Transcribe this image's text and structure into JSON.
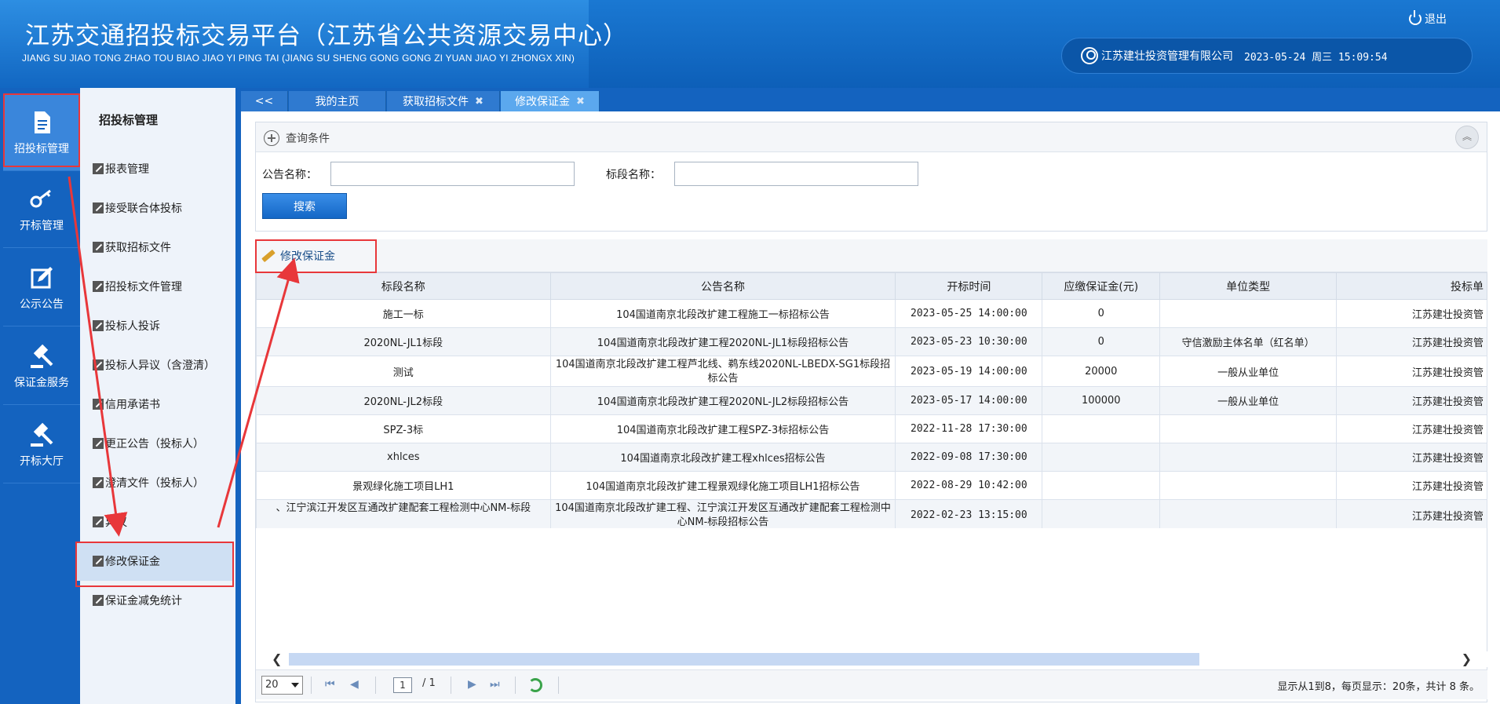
{
  "header": {
    "title_cn": "江苏交通招投标交易平台（江苏省公共资源交易中心）",
    "title_en": "JIANG SU JIAO TONG ZHAO TOU BIAO JIAO YI PING TAI  (JIANG SU SHENG GONG GONG ZI YUAN JIAO YI ZHONGX XIN)",
    "logout_label": "退出",
    "company": "江苏建壮投资管理有限公司",
    "datetime": "2023-05-24 周三 15:09:54"
  },
  "icon_nav": [
    {
      "label": "招投标管理",
      "icon": "document-icon"
    },
    {
      "label": "开标管理",
      "icon": "key-icon"
    },
    {
      "label": "公示公告",
      "icon": "edit-icon"
    },
    {
      "label": "保证金服务",
      "icon": "gavel-icon"
    },
    {
      "label": "开标大厅",
      "icon": "gavel-icon"
    }
  ],
  "sub_nav": {
    "title": "招投标管理",
    "items": [
      "报表管理",
      "接受联合体投标",
      "获取招标文件",
      "招投标文件管理",
      "投标人投诉",
      "投标人异议（含澄清）",
      "信用承诺书",
      "更正公告（投标人）",
      "澄清文件（投标人）",
      "异议",
      "修改保证金",
      "保证金减免统计"
    ]
  },
  "tabs": {
    "back_label": "<<",
    "items": [
      {
        "label": "我的主页",
        "closable": false
      },
      {
        "label": "获取招标文件",
        "closable": true
      },
      {
        "label": "修改保证金",
        "closable": true
      }
    ],
    "close_glyph": "✖"
  },
  "query": {
    "title": "查询条件",
    "field1_label": "公告名称：",
    "field1_value": "",
    "field2_label": "标段名称：",
    "field2_value": "",
    "search_label": "搜索"
  },
  "toolbar": {
    "edit_label": "修改保证金"
  },
  "table": {
    "columns": [
      "标段名称",
      "公告名称",
      "开标时间",
      "应缴保证金(元)",
      "单位类型",
      "投标单"
    ],
    "rows": [
      [
        "施工一标",
        "104国道南京北段改扩建工程施工一标招标公告",
        "2023-05-25 14:00:00",
        "0",
        "",
        "江苏建壮投资管"
      ],
      [
        "2020NL-JL1标段",
        "104国道南京北段改扩建工程2020NL-JL1标段招标公告",
        "2023-05-23 10:30:00",
        "0",
        "守信激励主体名单（红名单）",
        "江苏建壮投资管"
      ],
      [
        "测试",
        "104国道南京北段改扩建工程芦北线、鹈东线2020NL-LBEDX-SG1标段招标公告",
        "2023-05-19 14:00:00",
        "20000",
        "一般从业单位",
        "江苏建壮投资管"
      ],
      [
        "2020NL-JL2标段",
        "104国道南京北段改扩建工程2020NL-JL2标段招标公告",
        "2023-05-17 14:00:00",
        "100000",
        "一般从业单位",
        "江苏建壮投资管"
      ],
      [
        "SPZ-3标",
        "104国道南京北段改扩建工程SPZ-3标招标公告",
        "2022-11-28 17:30:00",
        "",
        "",
        "江苏建壮投资管"
      ],
      [
        "xhlces",
        "104国道南京北段改扩建工程xhlces招标公告",
        "2022-09-08 17:30:00",
        "",
        "",
        "江苏建壮投资管"
      ],
      [
        "景观绿化施工项目LH1",
        "104国道南京北段改扩建工程景观绿化施工项目LH1招标公告",
        "2022-08-29 10:42:00",
        "",
        "",
        "江苏建壮投资管"
      ],
      [
        "、江宁滨江开发区互通改扩建配套工程检测中心NM-标段",
        "104国道南京北段改扩建工程、江宁滨江开发区互通改扩建配套工程检测中心NM-标段招标公告",
        "2022-02-23 13:15:00",
        "",
        "",
        "江苏建壮投资管"
      ]
    ]
  },
  "pager": {
    "page_size": "20",
    "current_page": "1",
    "total_pages": "/ 1",
    "info": "显示从1到8，每页显示：20条，共计 8 条。"
  },
  "colors": {
    "header_blue": "#1463bf",
    "annotation_red": "#e8373a",
    "active_tab": "#5ba8ee"
  }
}
